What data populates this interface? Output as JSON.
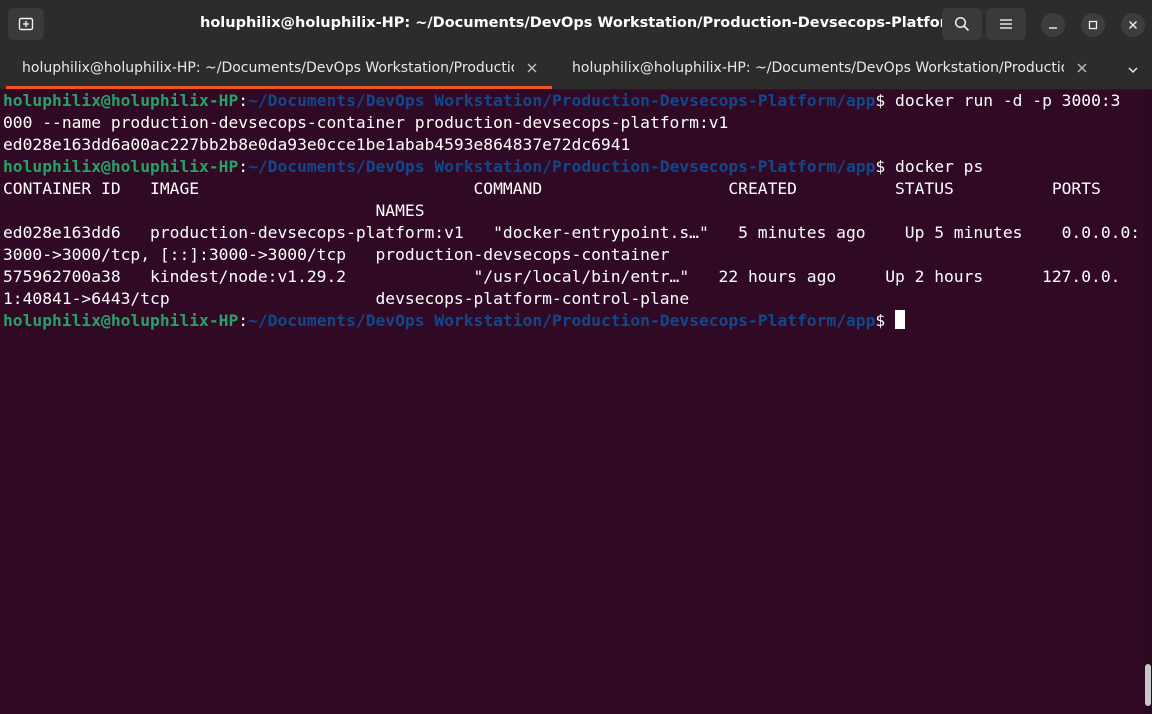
{
  "window": {
    "title": "holuphilix@holuphilix-HP: ~/Documents/DevOps Workstation/Production-Devsecops-Platform/app",
    "icons": {
      "new_tab": "new-tab-icon",
      "search": "search-icon",
      "menu": "hamburger-menu-icon",
      "minimize": "minimize-icon",
      "maximize": "maximize-icon",
      "close": "close-icon"
    }
  },
  "tabs": [
    {
      "label": "holuphilix@holuphilix-HP: ~/Documents/DevOps Workstation/Productio…",
      "active": true
    },
    {
      "label": "holuphilix@holuphilix-HP: ~/Documents/DevOps Workstation/Productio…",
      "active": false
    }
  ],
  "colors": {
    "terminal_bg": "#300a24",
    "prompt_user": "#26a269",
    "prompt_path": "#12488b",
    "accent": "#e95420"
  },
  "terminal": {
    "prompt": {
      "user": "holuphilix@holuphilix-HP",
      "colon": ":",
      "path": "~/Documents/DevOps Workstation/Production-Devsecops-Platform/app",
      "dollar": "$ "
    },
    "cmd1": "docker run -d -p 3000:3",
    "cmd1_wrap": "000 --name production-devsecops-container production-devsecops-platform:v1",
    "cmd1_output": "ed028e163dd6a00ac227bb2b8e0da93e0cce1be1abab4593e864837e72dc6941",
    "cmd2": "docker ps",
    "header1": "CONTAINER ID   IMAGE                            COMMAND                   CREATED          STATUS          PORTS",
    "header2": "                                      NAMES",
    "row1a": "ed028e163dd6   production-devsecops-platform:v1   \"docker-entrypoint.s…\"   5 minutes ago    Up 5 minutes    0.0.0.0:",
    "row1b": "3000->3000/tcp, [::]:3000->3000/tcp   production-devsecops-container",
    "row2a": "575962700a38   kindest/node:v1.29.2             \"/usr/local/bin/entr…\"   22 hours ago     Up 2 hours      127.0.0.",
    "row2b": "1:40841->6443/tcp                     devsecops-platform-control-plane"
  }
}
